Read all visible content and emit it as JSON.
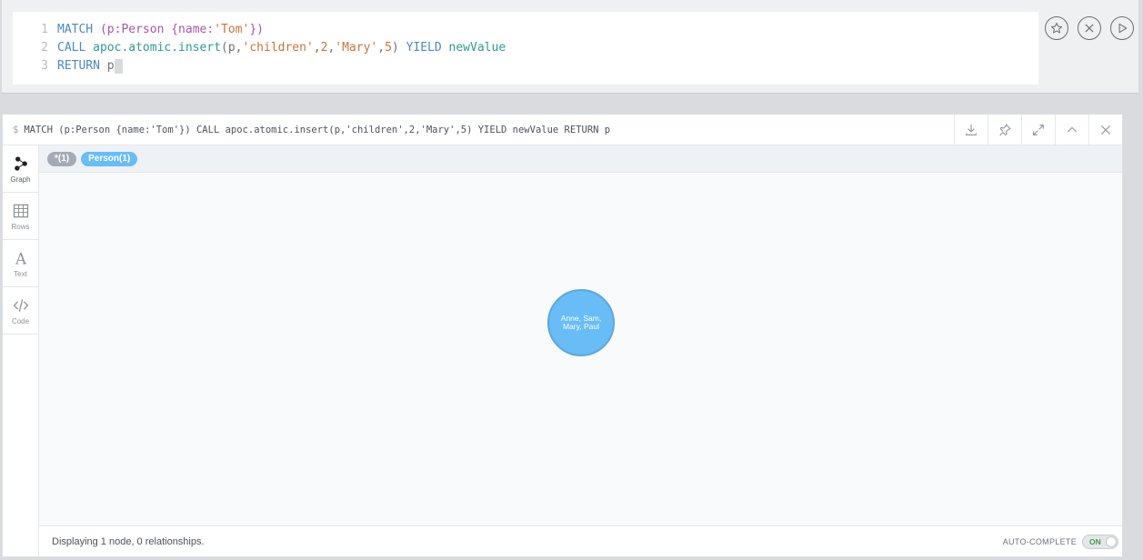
{
  "editor": {
    "lines": [
      {
        "num": "1",
        "tokens": [
          {
            "t": "MATCH ",
            "c": "kw"
          },
          {
            "t": "(p:Person {name:",
            "c": "label"
          },
          {
            "t": "'Tom'",
            "c": "str"
          },
          {
            "t": "})",
            "c": "label"
          }
        ]
      },
      {
        "num": "2",
        "tokens": [
          {
            "t": "CALL ",
            "c": "kw"
          },
          {
            "t": "apoc.atomic.insert",
            "c": "fn"
          },
          {
            "t": "(p,",
            "c": "plain"
          },
          {
            "t": "'children'",
            "c": "str"
          },
          {
            "t": ",",
            "c": "plain"
          },
          {
            "t": "2",
            "c": "num"
          },
          {
            "t": ",",
            "c": "plain"
          },
          {
            "t": "'Mary'",
            "c": "str"
          },
          {
            "t": ",",
            "c": "plain"
          },
          {
            "t": "5",
            "c": "num"
          },
          {
            "t": ") ",
            "c": "plain"
          },
          {
            "t": "YIELD ",
            "c": "kw"
          },
          {
            "t": "newValue",
            "c": "fn"
          }
        ]
      },
      {
        "num": "3",
        "tokens": [
          {
            "t": "RETURN ",
            "c": "kw"
          },
          {
            "t": "p",
            "c": "plain"
          }
        ]
      }
    ],
    "actions": [
      "favorite-star-icon",
      "clear-x-icon",
      "run-play-icon"
    ]
  },
  "frame": {
    "prompt_symbol": "$",
    "query": "MATCH (p:Person {name:'Tom'}) CALL apoc.atomic.insert(p,'children',2,'Mary',5) YIELD newValue RETURN p",
    "tools": [
      "download-icon",
      "pin-icon",
      "fullscreen-icon",
      "collapse-icon",
      "close-icon"
    ]
  },
  "tabs": [
    {
      "label": "Graph",
      "icon": "graph-icon",
      "active": true
    },
    {
      "label": "Rows",
      "icon": "table-icon",
      "active": false
    },
    {
      "label": "Text",
      "icon": "text-icon",
      "active": false
    },
    {
      "label": "Code",
      "icon": "code-icon",
      "active": false
    }
  ],
  "legend": {
    "all": "*(1)",
    "person": "Person(1)"
  },
  "node": {
    "caption": "Anne, Sam, Mary, Paul",
    "color": "#68bdf6"
  },
  "status": {
    "text": "Displaying 1 node, 0 relationships.",
    "autocomplete_label": "AUTO-COMPLETE",
    "toggle_label": "ON"
  }
}
